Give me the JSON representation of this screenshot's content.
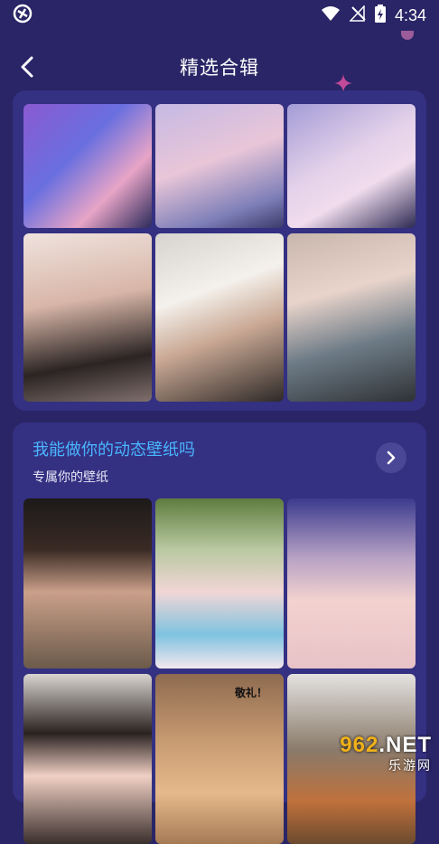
{
  "status_bar": {
    "time": "4:34"
  },
  "header": {
    "title": "精选合辑"
  },
  "section": {
    "title": "我能做你的动态壁纸吗",
    "subtitle": "专属你的壁纸"
  },
  "bottom_tiles": [
    {
      "overlay": ""
    },
    {
      "overlay": ""
    },
    {
      "overlay": ""
    },
    {
      "overlay": ""
    },
    {
      "overlay": "敬礼！"
    },
    {
      "overlay": ""
    }
  ],
  "watermark": {
    "number": "962",
    "suffix": ".NET",
    "site": "乐游网"
  },
  "colors": {
    "background": "#2a2566",
    "card": "#343082",
    "accent_title": "#49b6ff"
  }
}
